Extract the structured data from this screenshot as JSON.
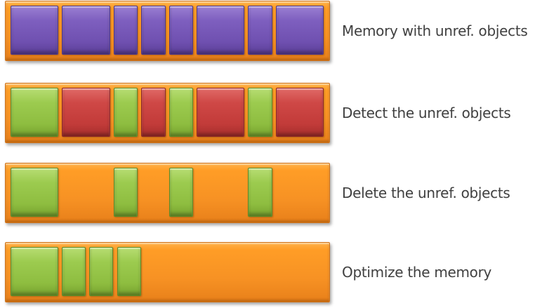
{
  "diagram": {
    "stages": [
      {
        "label": "Memory with unref. objects",
        "blocks": [
          "purple",
          "purple",
          "purple",
          "purple",
          "purple",
          "purple",
          "purple",
          "purple"
        ]
      },
      {
        "label": "Detect the unref. objects",
        "blocks": [
          "green",
          "red",
          "green",
          "red",
          "green",
          "red",
          "green",
          "red"
        ]
      },
      {
        "label": "Delete the unref. objects",
        "blocks": [
          "green",
          "empty",
          "green",
          "empty",
          "green",
          "empty",
          "green",
          "empty"
        ]
      },
      {
        "label": "Optimize the memory",
        "blocks": [
          "green",
          "green",
          "green",
          "green",
          "empty",
          "empty",
          "empty",
          "empty"
        ]
      }
    ],
    "colors": {
      "bar": "#f79224",
      "purple": "#7e5fbf",
      "green": "#9ccb4f",
      "red": "#cf4846",
      "text": "#404040"
    }
  }
}
